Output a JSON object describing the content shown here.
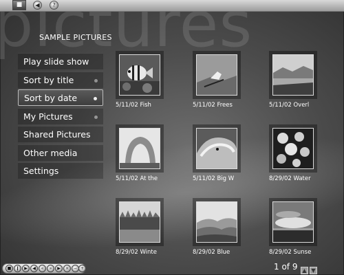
{
  "app": {
    "watermark": "pictures",
    "top_icons": [
      "media-center-logo",
      "back-icon",
      "help-icon"
    ]
  },
  "section_title": "SAMPLE PICTURES",
  "menu": {
    "items": [
      {
        "label": "Play slide show",
        "dot": false,
        "focused": false
      },
      {
        "label": "Sort by title",
        "dot": true,
        "focused": false
      },
      {
        "label": "Sort by date",
        "dot": true,
        "focused": true
      },
      {
        "label": "My Pictures",
        "dot": true,
        "focused": false
      },
      {
        "label": "Shared Pictures",
        "dot": false,
        "focused": false
      },
      {
        "label": "Other media",
        "dot": false,
        "focused": false
      },
      {
        "label": "Settings",
        "dot": false,
        "focused": false
      }
    ]
  },
  "pictures": [
    {
      "caption": "5/11/02  Fish",
      "subject": "fish"
    },
    {
      "caption": "5/11/02  Frees",
      "subject": "freestyle"
    },
    {
      "caption": "5/11/02  Overl",
      "subject": "overlook"
    },
    {
      "caption": "5/11/02  At the",
      "subject": "arch"
    },
    {
      "caption": "5/11/02  Big W",
      "subject": "wave"
    },
    {
      "caption": "8/29/02  Water",
      "subject": "water-lilies"
    },
    {
      "caption": "8/29/02  Winte",
      "subject": "winter"
    },
    {
      "caption": "8/29/02  Blue",
      "subject": "blue-hills"
    },
    {
      "caption": "8/29/02  Sunse",
      "subject": "sunset"
    }
  ],
  "pager": {
    "text": "1 of 9"
  },
  "transport": {
    "controls": [
      "stop",
      "pause",
      "play",
      "prev",
      "rewind",
      "forward",
      "next",
      "mute",
      "vol-down",
      "vol-up"
    ]
  }
}
